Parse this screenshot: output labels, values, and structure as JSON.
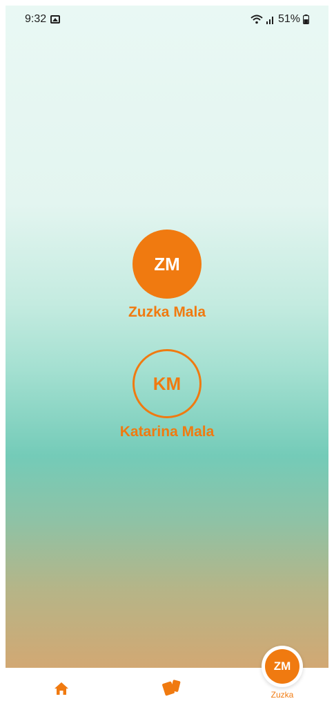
{
  "status_bar": {
    "time": "9:32",
    "battery": "51%",
    "icons": [
      "image-icon",
      "wifi-icon",
      "signal-icon",
      "battery-icon"
    ]
  },
  "profiles": [
    {
      "initials": "ZM",
      "name": "Zuzka Mala",
      "selected": true
    },
    {
      "initials": "KM",
      "name": "Katarina Mala",
      "selected": false
    }
  ],
  "bottom_nav": {
    "items": [
      {
        "icon": "home-icon"
      },
      {
        "icon": "cards-icon"
      },
      {
        "icon": "profile-avatar",
        "initials": "ZM",
        "label": "Zuzka"
      }
    ]
  },
  "colors": {
    "accent": "#f07a10",
    "gradient_top": "#e9f8f4",
    "gradient_mid": "#74cbb8",
    "gradient_bottom": "#d2a873"
  }
}
